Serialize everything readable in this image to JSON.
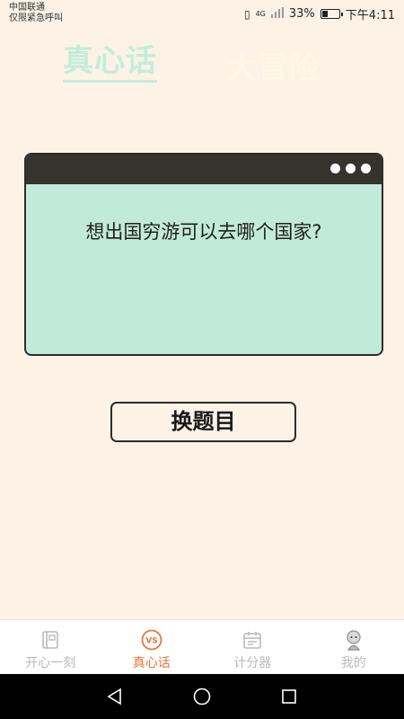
{
  "status_bar": {
    "carrier": "中国联通",
    "emergency": "仅限紧急呼叫",
    "network": "4G",
    "battery_percent": "33%",
    "battery_level": 0.33,
    "time": "下午4:11"
  },
  "top_tabs": [
    {
      "label": "真心话",
      "active": true
    },
    {
      "label": "大冒险",
      "active": false
    }
  ],
  "card": {
    "question": "想出国穷游可以去哪个国家?"
  },
  "change_button": {
    "label": "换题目"
  },
  "bottom_nav": [
    {
      "label": "开心一刻",
      "icon": "notebook-icon",
      "active": false
    },
    {
      "label": "真心话",
      "icon": "vs-icon",
      "active": true
    },
    {
      "label": "计分器",
      "icon": "calendar-icon",
      "active": false
    },
    {
      "label": "我的",
      "icon": "avatar-icon",
      "active": false
    }
  ],
  "colors": {
    "background": "#fcf2e6",
    "card": "#c2eada",
    "accent": "#e8743a",
    "dark": "#35332e"
  }
}
